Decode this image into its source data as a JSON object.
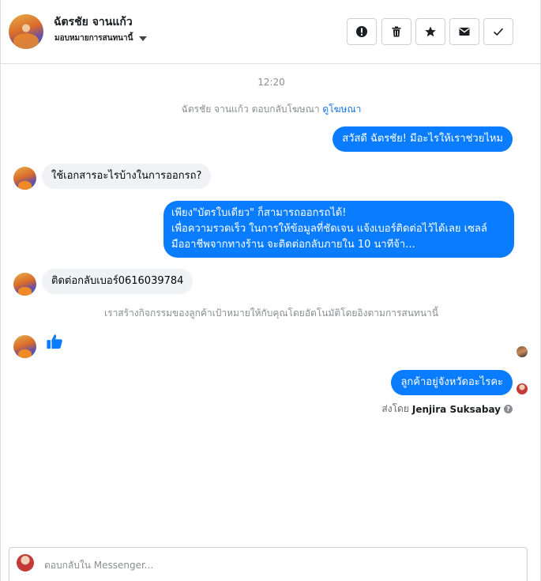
{
  "header": {
    "contact_name": "ฉัตรชัย จานแก้ว",
    "assign_label": "มอบหมายการสนทนานี้"
  },
  "toolbar": {
    "spam_icon": "alert-circle-icon",
    "delete_icon": "trash-icon",
    "star_icon": "star-icon",
    "unread_icon": "envelope-icon",
    "done_icon": "checkmark-icon"
  },
  "conversation": {
    "timestamp": "12:20",
    "ad_reply_text": "ฉัตรชัย จานแก้ว ตอบกลับโฆษณา",
    "ad_reply_link": "ดูโฆษณา",
    "messages": [
      {
        "direction": "out",
        "text": "สวัสดี ฉัตรชัย! มีอะไรให้เราช่วยไหม"
      },
      {
        "direction": "in",
        "text": "ใช้เอกสารอะไรบ้างในการออกรถ?"
      },
      {
        "direction": "out",
        "lines": [
          "เพียง\"บัตรใบเดียว\" ก็สามารถออกรถได้!",
          "เพื่อความรวดเร็ว ในการให้ข้อมูลที่ชัดเจน แจ้งเบอร์ติดต่อไว้ได้เลย เซลล์",
          "มืออาชีพจากทางร้าน จะติดต่อกลับภายใน 10 นาทีจ้า..."
        ]
      },
      {
        "direction": "in",
        "text": "ติดต่อกลับเบอร์0616039784"
      },
      {
        "direction": "in",
        "type": "like",
        "icon": "thumbs-up-icon"
      },
      {
        "direction": "out",
        "text": "ลูกค้าอยู่จังหวัดอะไรคะ"
      }
    ],
    "system_notice": "เราสร้างกิจกรรมของลูกค้าเป้าหมายให้กับคุณโดยอัตโนมัติโดยอิงตามการสนทนานี้",
    "sent_by_prefix": "ส่งโดย",
    "sent_by_name": "Jenjira Suksabay"
  },
  "composer": {
    "placeholder": "ตอบกลับใน Messenger..."
  },
  "colors": {
    "outgoing_bubble": "#0a7cff",
    "incoming_bubble": "#f0f2f5",
    "link": "#1b74e4"
  }
}
